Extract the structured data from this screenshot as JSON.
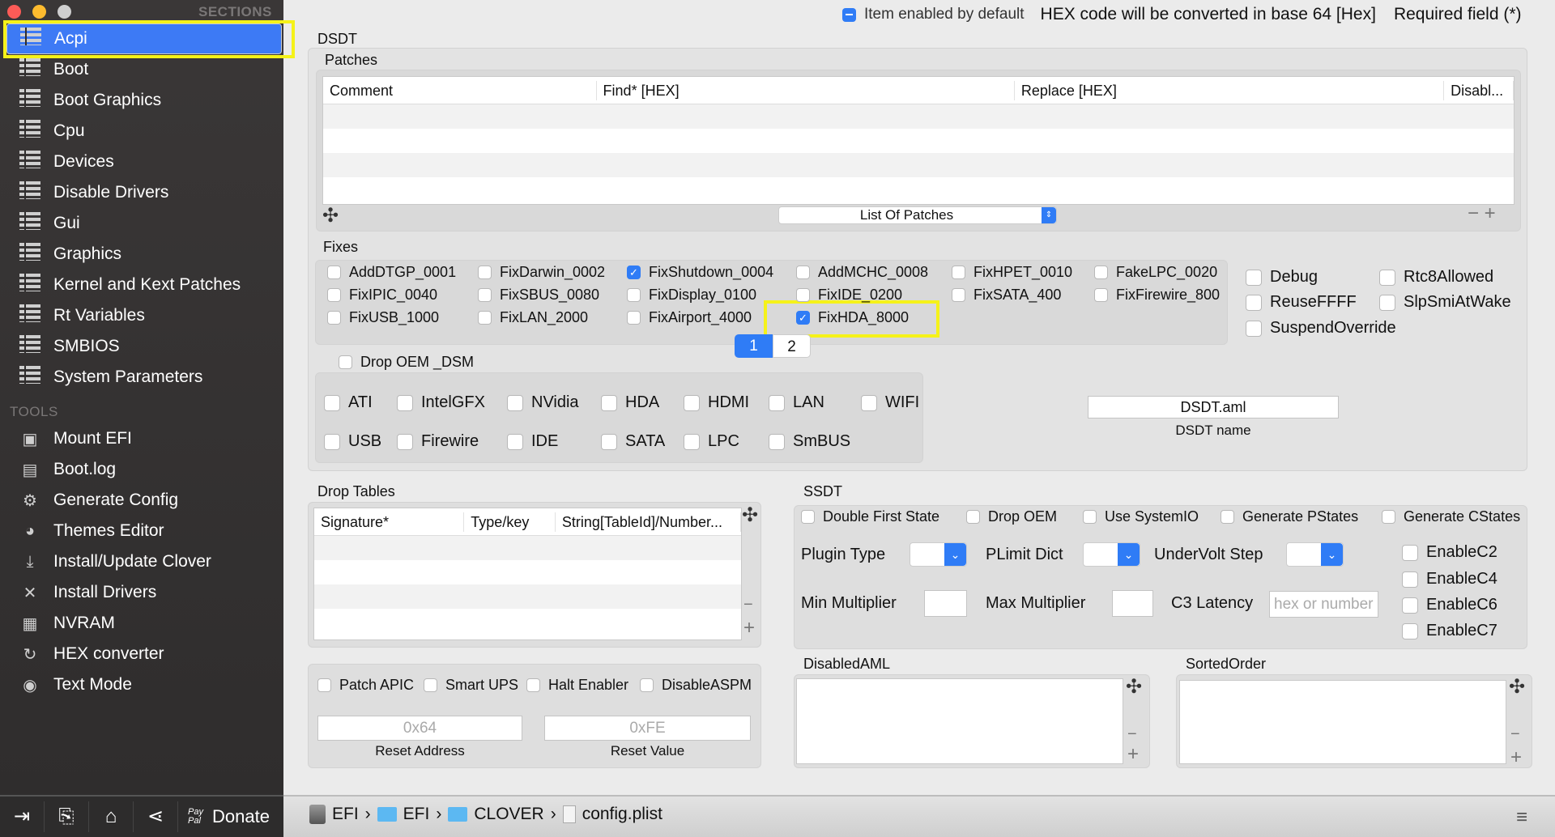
{
  "window": {
    "sections_label": "SECTIONS",
    "tools_label": "TOOLS"
  },
  "sidebar": {
    "selected": "Acpi",
    "sections": [
      {
        "label": "Acpi"
      },
      {
        "label": "Boot"
      },
      {
        "label": "Boot Graphics"
      },
      {
        "label": "Cpu"
      },
      {
        "label": "Devices"
      },
      {
        "label": "Disable Drivers"
      },
      {
        "label": "Gui"
      },
      {
        "label": "Graphics"
      },
      {
        "label": "Kernel and Kext Patches"
      },
      {
        "label": "Rt Variables"
      },
      {
        "label": "SMBIOS"
      },
      {
        "label": "System Parameters"
      }
    ],
    "tools": [
      {
        "label": "Mount EFI",
        "icon": "disk-icon"
      },
      {
        "label": "Boot.log",
        "icon": "log-icon"
      },
      {
        "label": "Generate Config",
        "icon": "gear-icon"
      },
      {
        "label": "Themes Editor",
        "icon": "palette-icon"
      },
      {
        "label": "Install/Update Clover",
        "icon": "download-icon"
      },
      {
        "label": "Install Drivers",
        "icon": "tools-icon"
      },
      {
        "label": "NVRAM",
        "icon": "chip-icon"
      },
      {
        "label": "HEX converter",
        "icon": "refresh-icon"
      },
      {
        "label": "Text Mode",
        "icon": "eye-icon"
      }
    ]
  },
  "header": {
    "legend_enabled": "Item enabled by default",
    "hex_note": "HEX code will be converted in base 64 [Hex]",
    "required_note": "Required field (*)"
  },
  "dsdt": {
    "title": "DSDT",
    "patches": {
      "label": "Patches",
      "columns": [
        "Comment",
        "Find* [HEX]",
        "Replace [HEX]",
        "Disabl..."
      ],
      "popup": "List Of Patches"
    },
    "fixes": {
      "label": "Fixes",
      "items": [
        {
          "label": "AddDTGP_0001",
          "checked": false
        },
        {
          "label": "FixDarwin_0002",
          "checked": false
        },
        {
          "label": "FixShutdown_0004",
          "checked": true
        },
        {
          "label": "AddMCHC_0008",
          "checked": false
        },
        {
          "label": "FixHPET_0010",
          "checked": false
        },
        {
          "label": "FakeLPC_0020",
          "checked": false
        },
        {
          "label": "FixIPIC_0040",
          "checked": false
        },
        {
          "label": "FixSBUS_0080",
          "checked": false
        },
        {
          "label": "FixDisplay_0100",
          "checked": false
        },
        {
          "label": "FixIDE_0200",
          "checked": false
        },
        {
          "label": "FixSATA_400",
          "checked": false
        },
        {
          "label": "FixFirewire_800",
          "checked": false
        },
        {
          "label": "FixUSB_1000",
          "checked": false
        },
        {
          "label": "FixLAN_2000",
          "checked": false
        },
        {
          "label": "FixAirport_4000",
          "checked": false
        },
        {
          "label": "FixHDA_8000",
          "checked": true
        }
      ],
      "pages": [
        "1",
        "2"
      ],
      "current_page": "1"
    },
    "options": [
      {
        "label": "Debug",
        "checked": false
      },
      {
        "label": "Rtc8Allowed",
        "checked": false
      },
      {
        "label": "ReuseFFFF",
        "checked": false
      },
      {
        "label": "SlpSmiAtWake",
        "checked": false
      },
      {
        "label": "SuspendOverride",
        "checked": false
      }
    ],
    "drop_oem_dsm": {
      "label": "Drop OEM _DSM",
      "checked": false
    },
    "devices": [
      {
        "label": "ATI"
      },
      {
        "label": "IntelGFX"
      },
      {
        "label": "NVidia"
      },
      {
        "label": "HDA"
      },
      {
        "label": "HDMI"
      },
      {
        "label": "LAN"
      },
      {
        "label": "WIFI"
      },
      {
        "label": "USB"
      },
      {
        "label": "Firewire"
      },
      {
        "label": "IDE"
      },
      {
        "label": "SATA"
      },
      {
        "label": "LPC"
      },
      {
        "label": "SmBUS"
      }
    ],
    "dsdt_name": {
      "value": "DSDT.aml",
      "label": "DSDT name"
    }
  },
  "drop_tables": {
    "label": "Drop Tables",
    "columns": [
      "Signature*",
      "Type/key",
      "String[TableId]/Number..."
    ]
  },
  "misc": {
    "checkboxes": [
      {
        "label": "Patch APIC"
      },
      {
        "label": "Smart UPS"
      },
      {
        "label": "Halt Enabler"
      },
      {
        "label": "DisableASPM"
      }
    ],
    "reset_address": {
      "placeholder": "0x64",
      "label": "Reset Address"
    },
    "reset_value": {
      "placeholder": "0xFE",
      "label": "Reset Value"
    }
  },
  "ssdt": {
    "label": "SSDT",
    "checkboxes": [
      {
        "label": "Double First State"
      },
      {
        "label": "Drop OEM"
      },
      {
        "label": "Use SystemIO"
      },
      {
        "label": "Generate PStates"
      },
      {
        "label": "Generate CStates"
      }
    ],
    "plugin_type": "Plugin Type",
    "plimit_dict": "PLimit Dict",
    "undervolt_step": "UnderVolt Step",
    "min_multiplier": "Min Multiplier",
    "max_multiplier": "Max Multiplier",
    "c3_latency": "C3 Latency",
    "c3_placeholder": "hex or number",
    "enable": [
      {
        "label": "EnableC2"
      },
      {
        "label": "EnableC4"
      },
      {
        "label": "EnableC6"
      },
      {
        "label": "EnableC7"
      }
    ]
  },
  "disabled_aml": {
    "label": "DisabledAML"
  },
  "sorted_order": {
    "label": "SortedOrder"
  },
  "bottom": {
    "donate": "Donate",
    "paypal": "Pay Pal",
    "breadcrumb": [
      "EFI",
      "EFI",
      "CLOVER",
      "config.plist"
    ]
  },
  "colors": {
    "accent": "#3d7af5",
    "highlight": "#f5f219",
    "sidebar": "#2f2d2d"
  }
}
